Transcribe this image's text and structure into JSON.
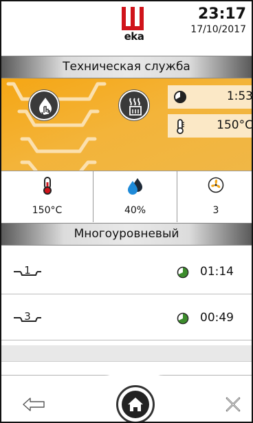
{
  "header": {
    "brand": "eka",
    "time": "23:17",
    "date": "17/10/2017"
  },
  "service_title": "Техническая служба",
  "process": {
    "timer": "1:53",
    "temperature": "150°C"
  },
  "stats": [
    {
      "icon": "thermometer-icon",
      "value": "150°C"
    },
    {
      "icon": "humidity-icon",
      "value": "40%"
    },
    {
      "icon": "fan-icon",
      "value": "3"
    }
  ],
  "mode_title": "Многоуровневый",
  "shelves": [
    {
      "level": "1",
      "time": "01:14"
    },
    {
      "level": "3",
      "time": "00:49"
    }
  ],
  "colors": {
    "brand_red": "#d0141b",
    "panel_orange": "#f5a614",
    "status_green": "#3c8c2c"
  }
}
